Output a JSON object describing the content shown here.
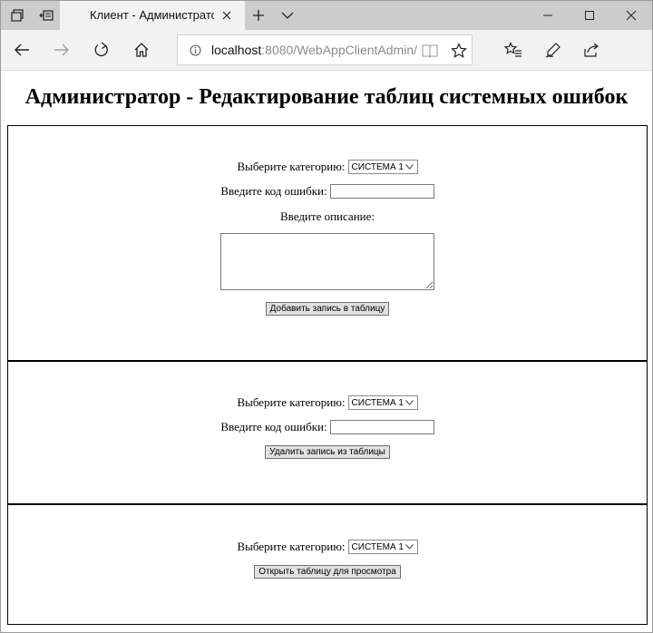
{
  "browser": {
    "tab_title": "Клиент - Администратор",
    "address": {
      "host": "localhost",
      "path": ":8080/WebAppClientAdmin/"
    },
    "icons": {
      "tab_set_aside": "tabs-icon",
      "tab_back": "set-aside-icon",
      "new_tab": "plus-icon",
      "tab_list": "chevron-down-icon",
      "minimize": "minimize-icon",
      "maximize": "maximize-icon",
      "close": "close-icon",
      "back": "back-arrow-icon",
      "forward": "forward-arrow-icon",
      "refresh": "refresh-icon",
      "home": "home-icon",
      "reading_view": "book-icon",
      "favorite": "star-icon",
      "favorites_hub": "favorites-list-icon",
      "notes": "pen-icon",
      "share": "share-icon"
    }
  },
  "page": {
    "title": "Администратор - Редактирование таблиц системных ошибок",
    "add_section": {
      "category_label": "Выберите категорию:",
      "category_value": "СИСТЕМА 1",
      "code_label": "Введите код ошибки:",
      "code_value": "",
      "description_label": "Введите описание:",
      "description_value": "",
      "submit_label": "Добавить запись в таблицу"
    },
    "delete_section": {
      "category_label": "Выберите категорию:",
      "category_value": "СИСТЕМА 1",
      "code_label": "Введите код ошибки:",
      "code_value": "",
      "submit_label": "Удалить запись из таблицы"
    },
    "view_section": {
      "category_label": "Выберите категорию:",
      "category_value": "СИСТЕМА 1",
      "submit_label": "Открыть таблицу для просмотра"
    }
  }
}
